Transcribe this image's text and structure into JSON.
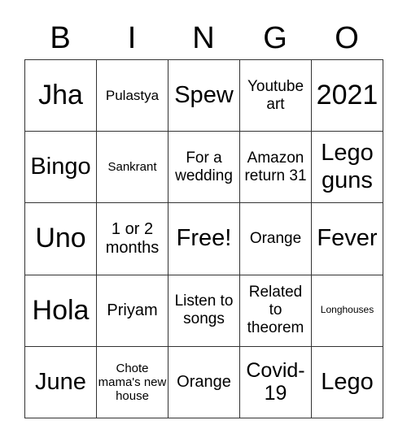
{
  "title_letters": [
    "B",
    "I",
    "N",
    "G",
    "O"
  ],
  "rows": [
    [
      "Jha",
      "Pulastya",
      "Spew",
      "Youtube art",
      "2021"
    ],
    [
      "Bingo",
      "Sankrant",
      "For a wedding",
      "Amazon return 31",
      "Lego guns"
    ],
    [
      "Uno",
      "1 or 2 months",
      "Free!",
      "Orange",
      "Fever"
    ],
    [
      "Hola",
      "Priyam",
      "Listen to songs",
      "Related to theorem",
      "Longhouses"
    ],
    [
      "June",
      "Chote mama's new house",
      "Orange",
      "Covid-19",
      "Lego"
    ]
  ]
}
